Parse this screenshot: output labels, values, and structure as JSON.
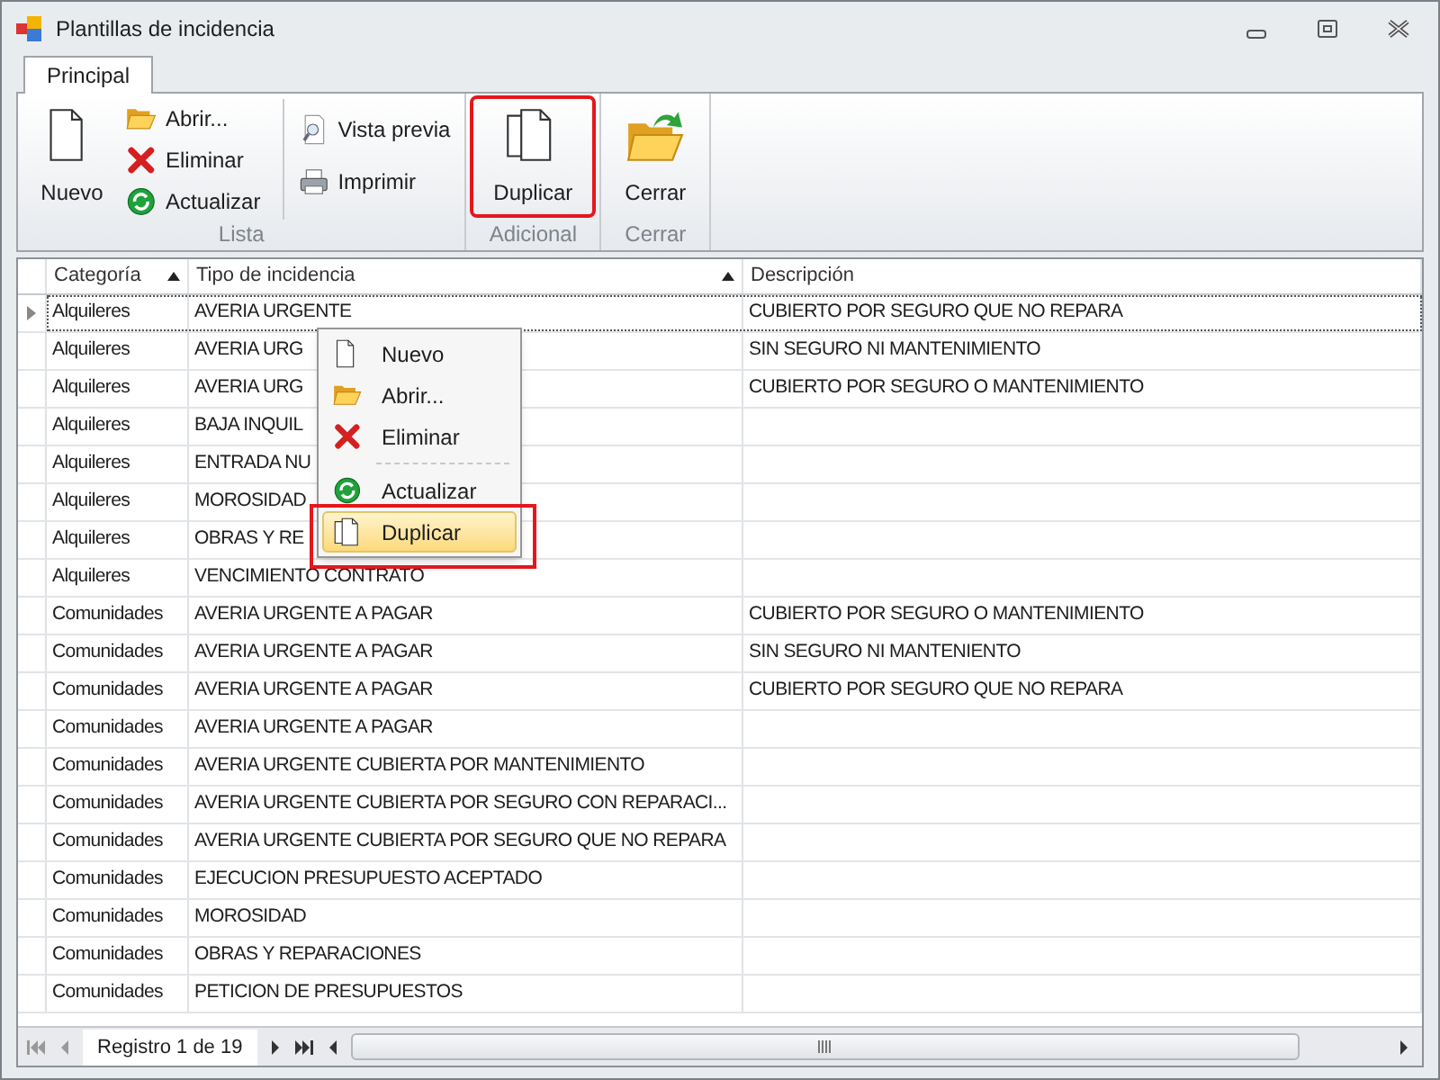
{
  "window": {
    "title": "Plantillas de incidencia"
  },
  "tabs": [
    {
      "label": "Principal",
      "selected": true
    }
  ],
  "ribbon": {
    "groups": [
      {
        "label": "Lista",
        "columns": [
          [
            {
              "label": "Nuevo",
              "kind": "new",
              "large": true,
              "highlighted": false
            }
          ],
          [
            {
              "label": "Abrir...",
              "kind": "open",
              "large": false,
              "highlighted": false
            },
            {
              "label": "Eliminar",
              "kind": "delete",
              "large": false,
              "highlighted": false
            },
            {
              "label": "Actualizar",
              "kind": "refresh",
              "large": false,
              "highlighted": false
            }
          ],
          [
            {
              "label": "Vista previa",
              "kind": "preview",
              "large": false,
              "highlighted": false
            },
            {
              "label": "Imprimir",
              "kind": "print",
              "large": false,
              "highlighted": false
            }
          ]
        ]
      },
      {
        "label": "Adicional",
        "columns": [
          [
            {
              "label": "Duplicar",
              "kind": "duplicate",
              "large": true,
              "highlighted": true
            }
          ]
        ]
      },
      {
        "label": "Cerrar",
        "columns": [
          [
            {
              "label": "Cerrar",
              "kind": "close",
              "large": true,
              "highlighted": false
            }
          ]
        ]
      }
    ]
  },
  "table": {
    "columns": [
      {
        "label": "Categoría",
        "sorted": true
      },
      {
        "label": "Tipo de incidencia",
        "sorted": true
      },
      {
        "label": "Descripción",
        "sorted": false
      }
    ],
    "rows": [
      {
        "current": true,
        "cells": [
          "Alquileres",
          "AVERIA URGENTE",
          "CUBIERTO POR SEGURO QUE NO REPARA"
        ]
      },
      {
        "current": false,
        "cells": [
          "Alquileres",
          "AVERIA URG",
          "SIN SEGURO NI MANTENIMIENTO"
        ]
      },
      {
        "current": false,
        "cells": [
          "Alquileres",
          "AVERIA URG",
          "CUBIERTO POR SEGURO O MANTENIMIENTO"
        ]
      },
      {
        "current": false,
        "cells": [
          "Alquileres",
          "BAJA INQUIL",
          ""
        ]
      },
      {
        "current": false,
        "cells": [
          "Alquileres",
          "ENTRADA NU",
          ""
        ]
      },
      {
        "current": false,
        "cells": [
          "Alquileres",
          "MOROSIDAD",
          ""
        ]
      },
      {
        "current": false,
        "cells": [
          "Alquileres",
          "OBRAS Y RE",
          ""
        ]
      },
      {
        "current": false,
        "cells": [
          "Alquileres",
          "VENCIMIENTO CONTRATO",
          ""
        ]
      },
      {
        "current": false,
        "cells": [
          "Comunidades",
          "AVERIA URGENTE A PAGAR",
          "CUBIERTO POR SEGURO O MANTENIMIENTO"
        ]
      },
      {
        "current": false,
        "cells": [
          "Comunidades",
          "AVERIA URGENTE A PAGAR",
          "SIN SEGURO NI MANTENIENTO"
        ]
      },
      {
        "current": false,
        "cells": [
          "Comunidades",
          "AVERIA URGENTE A PAGAR",
          "CUBIERTO POR SEGURO QUE NO REPARA"
        ]
      },
      {
        "current": false,
        "cells": [
          "Comunidades",
          "AVERIA URGENTE A PAGAR",
          ""
        ]
      },
      {
        "current": false,
        "cells": [
          "Comunidades",
          "AVERIA URGENTE CUBIERTA POR MANTENIMIENTO",
          ""
        ]
      },
      {
        "current": false,
        "cells": [
          "Comunidades",
          "AVERIA URGENTE CUBIERTA POR SEGURO CON REPARACI...",
          ""
        ]
      },
      {
        "current": false,
        "cells": [
          "Comunidades",
          "AVERIA URGENTE CUBIERTA POR SEGURO QUE NO REPARA",
          ""
        ]
      },
      {
        "current": false,
        "cells": [
          "Comunidades",
          "EJECUCION PRESUPUESTO ACEPTADO",
          ""
        ]
      },
      {
        "current": false,
        "cells": [
          "Comunidades",
          "MOROSIDAD",
          ""
        ]
      },
      {
        "current": false,
        "cells": [
          "Comunidades",
          "OBRAS Y REPARACIONES",
          ""
        ]
      },
      {
        "current": false,
        "cells": [
          "Comunidades",
          "PETICION DE PRESUPUESTOS",
          ""
        ]
      }
    ]
  },
  "context_menu": {
    "items": [
      {
        "label": "Nuevo",
        "kind": "new",
        "selected": false,
        "highlighted": false
      },
      {
        "label": "Abrir...",
        "kind": "open",
        "selected": false,
        "highlighted": false
      },
      {
        "label": "Eliminar",
        "kind": "delete",
        "selected": false,
        "highlighted": false
      },
      {
        "label": "Actualizar",
        "kind": "refresh",
        "separator_before": true,
        "selected": false,
        "highlighted": false
      },
      {
        "label": "Duplicar",
        "kind": "duplicate",
        "selected": true,
        "highlighted": true
      }
    ]
  },
  "navigator": {
    "record": "Registro 1 de 19"
  }
}
